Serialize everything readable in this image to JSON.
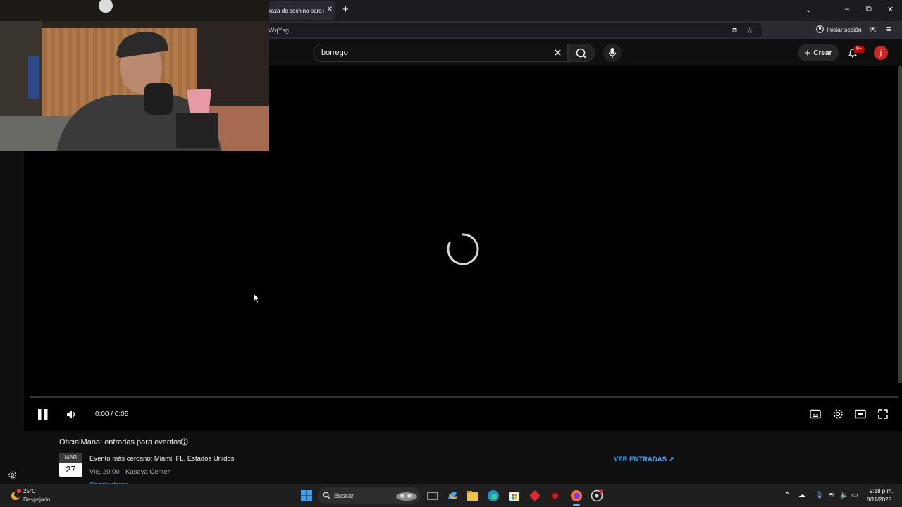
{
  "browser": {
    "tab_title": "raza de cochino para s",
    "url_fragment": "WqYsg",
    "signin_label": "Iniciar sesión"
  },
  "youtube": {
    "search_value": "borrego",
    "create_label": "Crear",
    "notification_badge": "9+",
    "avatar_letter": "j"
  },
  "player": {
    "time_display": "0:00 / 0:05",
    "state": "loading"
  },
  "event_card": {
    "title": "OficialMana: entradas para eventos",
    "month": "MAR",
    "day": "27",
    "line1": "Evento más cercano: Miami, FL, Estados Unidos",
    "line2": "Vie, 20:00 · Kaseya Center",
    "line3": "Bandsintown",
    "action_label": "VER ENTRADAS ↗"
  },
  "taskbar": {
    "weather_temp": "25°C",
    "weather_desc": "Despejado",
    "search_label": "Buscar",
    "clock_time": "9:18 p.m.",
    "clock_date": "8/11/2025"
  }
}
